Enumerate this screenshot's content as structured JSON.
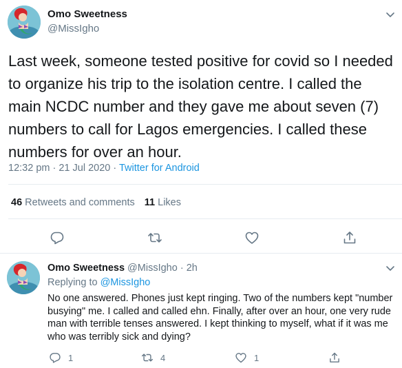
{
  "main_tweet": {
    "author_name": "Omo Sweetness",
    "author_handle": "@MissIgho",
    "text": "Last week, someone tested positive for covid so I needed to organize his trip to the isolation centre. I called the main NCDC number and they gave me about seven (7) numbers to call for Lagos emergencies. I called these numbers for over an hour.",
    "time": "12:32 pm",
    "date": "21 Jul 2020",
    "separator": " · ",
    "source": "Twitter for Android",
    "retweets_count": "46",
    "retweets_label": "Retweets and comments",
    "likes_count": "11",
    "likes_label": "Likes"
  },
  "reply_tweet": {
    "author_name": "Omo Sweetness",
    "author_handle": "@MissIgho",
    "age": "2h",
    "separator": " · ",
    "replying_label": "Replying to",
    "replying_handle": "@MissIgho",
    "text": "No one answered. Phones just kept ringing. Two of the numbers kept \"number busying\" me. I called and called ehn. Finally, after over an hour, one very rude man with terrible tenses answered. I kept thinking to myself, what if it was me who was terribly sick and dying?",
    "reply_count": "1",
    "retweet_count": "4",
    "like_count": "1"
  },
  "colors": {
    "text": "#14171a",
    "secondary": "#657786",
    "link": "#1b95e0",
    "divider": "#e6ecf0"
  },
  "icons": [
    "chevron-down-icon",
    "reply-icon",
    "retweet-icon",
    "like-icon",
    "share-icon"
  ]
}
